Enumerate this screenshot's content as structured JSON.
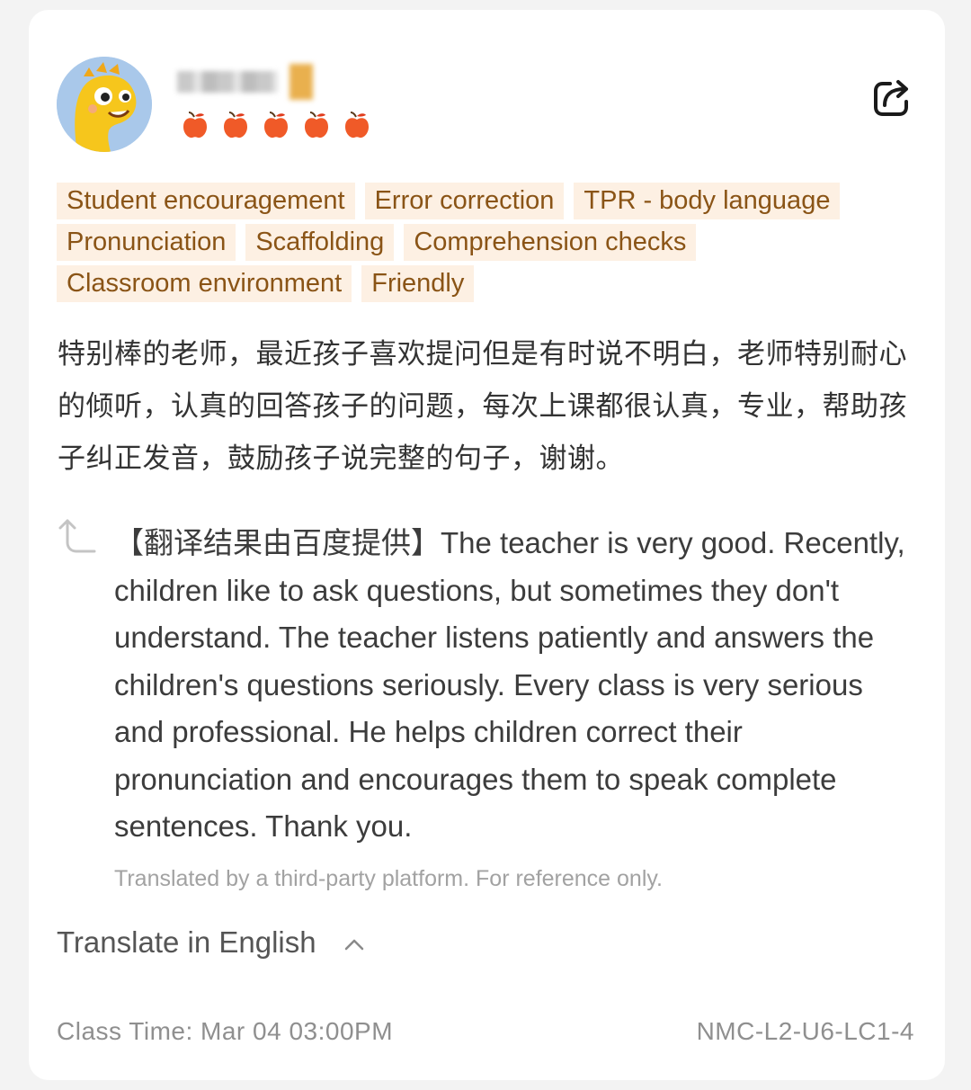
{
  "header": {
    "rating_max": 5,
    "rating_value": 5,
    "rating_icon": "apple-icon",
    "share_icon": "share-icon"
  },
  "tags": [
    "Student encouragement",
    "Error correction",
    "TPR - body language",
    "Pronunciation",
    "Scaffolding",
    "Comprehension checks",
    "Classroom environment",
    "Friendly"
  ],
  "review": {
    "text": "特别棒的老师，最近孩子喜欢提问但是有时说不明白，老师特别耐心的倾听，认真的回答孩子的问题，每次上课都很认真，专业，帮助孩子纠正发音，鼓励孩子说完整的句子，谢谢。"
  },
  "translation": {
    "text": "【翻译结果由百度提供】The teacher is very good. Recently, children like to ask questions, but sometimes they don't understand. The teacher listens patiently and answers the children's questions seriously. Every class is very serious and professional. He helps children correct their pronunciation and encourages them to speak complete sentences. Thank you.",
    "disclaimer": "Translated by a third-party platform. For reference only.",
    "toggle_label": "Translate in English"
  },
  "footer": {
    "class_time": "Class Time: Mar 04 03:00PM",
    "course_code": "NMC-L2-U6-LC1-4"
  },
  "colors": {
    "tag_bg": "#fdf0e3",
    "tag_text": "#8a5416",
    "apple": "#f05a28",
    "avatar_bg": "#a9c8ea",
    "mascot": "#f6c61c"
  }
}
